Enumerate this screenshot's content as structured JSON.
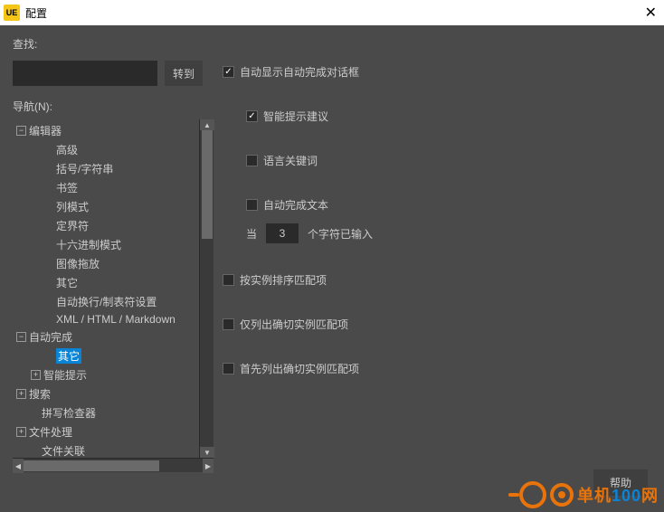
{
  "titlebar": {
    "logo": "UE",
    "title": "配置"
  },
  "search": {
    "label": "查找:",
    "go": "转到"
  },
  "nav": {
    "label": "导航(N):"
  },
  "tree": {
    "editor": "编辑器",
    "advanced": "高级",
    "brackets": "括号/字符串",
    "bookmarks": "书签",
    "columnmode": "列模式",
    "delimiter": "定界符",
    "hexmode": "十六进制模式",
    "imagedrop": "图像拖放",
    "other1": "其它",
    "wrap": "自动换行/制表符设置",
    "xml": "XML / HTML / Markdown",
    "autocomplete": "自动完成",
    "other2": "其它",
    "intelli": "智能提示",
    "search2": "搜索",
    "spell": "拼写检查器",
    "filehandle": "文件处理",
    "fileassoc": "文件关联"
  },
  "opts": {
    "autoshow": "自动显示自动完成对话框",
    "intellisuggest": "智能提示建议",
    "langkeyword": "语言关键词",
    "autotext": "自动完成文本",
    "when": "当",
    "chars": "3",
    "charstyped": "个字符已输入",
    "sortcase": "按实例排序匹配项",
    "listexact": "仅列出确切实例匹配项",
    "firstexact": "首先列出确切实例匹配项"
  },
  "help": "帮助",
  "watermark": {
    "pre": "单机",
    "num": "100",
    "suf": "网"
  }
}
